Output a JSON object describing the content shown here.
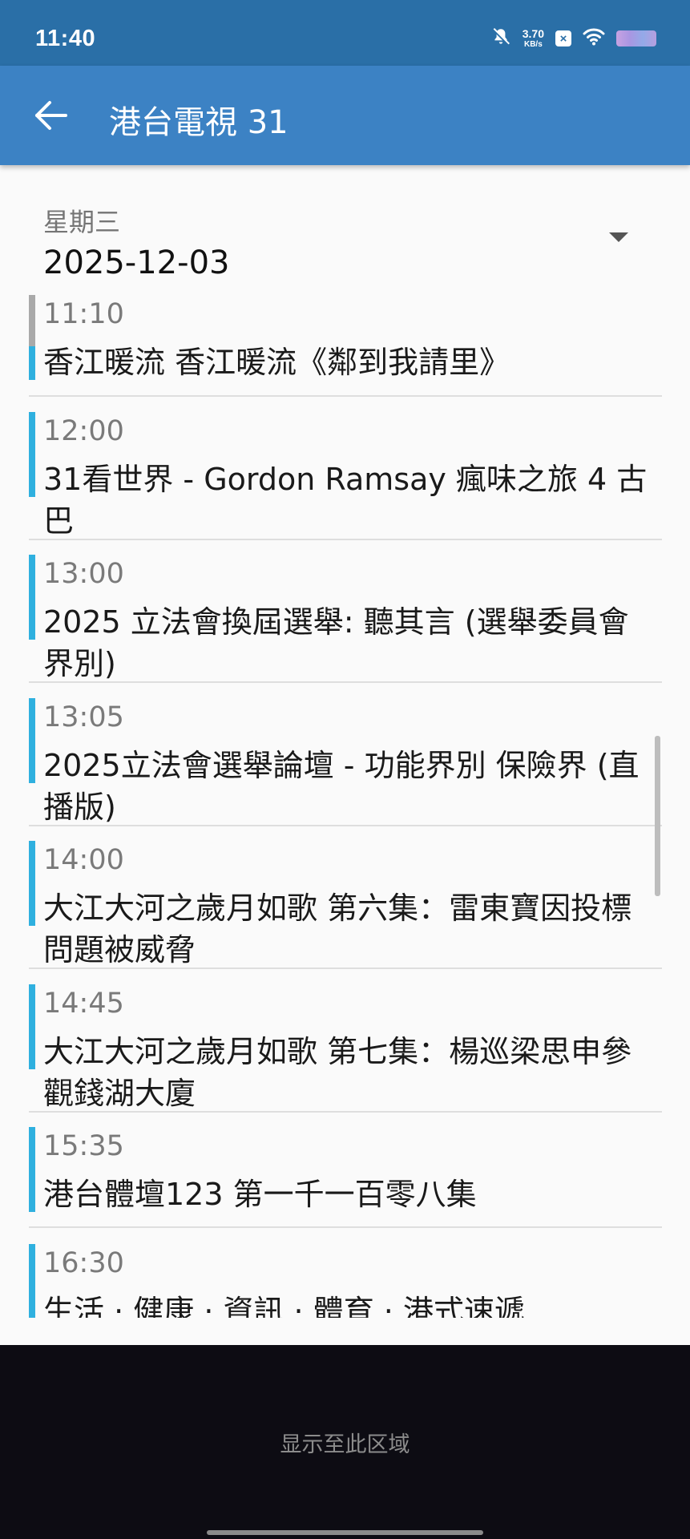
{
  "status_bar": {
    "time": "11:40",
    "net_speed_value": "3.70",
    "net_speed_unit": "KB/s",
    "icons": [
      "mute-bell-icon",
      "x-badge-icon",
      "wifi-icon",
      "battery-icon"
    ]
  },
  "app_bar": {
    "back_icon": "back-arrow-icon",
    "title": "港台電視 31"
  },
  "date_selector": {
    "weekday": "星期三",
    "date": "2025-12-03",
    "dropdown_icon": "dropdown-arrow-icon"
  },
  "schedule": [
    {
      "time": "11:10",
      "title": "香江暖流 香江暖流《鄰到我請里》"
    },
    {
      "time": "12:00",
      "title": "31看世界 - Gordon Ramsay 瘋味之旅 4 古巴"
    },
    {
      "time": "13:00",
      "title": "2025 立法會換屆選舉: 聽其言 (選舉委員會界別)"
    },
    {
      "time": "13:05",
      "title": "2025立法會選舉論壇 - 功能界別 保險界 (直播版)"
    },
    {
      "time": "14:00",
      "title": "大江大河之歲月如歌 第六集：雷東寶因投標問題被威脅"
    },
    {
      "time": "14:45",
      "title": "大江大河之歲月如歌 第七集：楊巡梁思申參觀錢湖大廈"
    },
    {
      "time": "15:35",
      "title": "港台體壇123 第一千一百零八集"
    },
    {
      "time": "16:30",
      "title": "生活 · 健康 · 資訊 · 體育 · 港式速遞"
    }
  ],
  "bottom_panel": {
    "label": "显示至此区域"
  },
  "colors": {
    "status_bar": "#2a6fa7",
    "app_bar": "#3c82c4",
    "item_accent": "#2fb0df",
    "elapsed_accent": "#a9a9a9"
  }
}
